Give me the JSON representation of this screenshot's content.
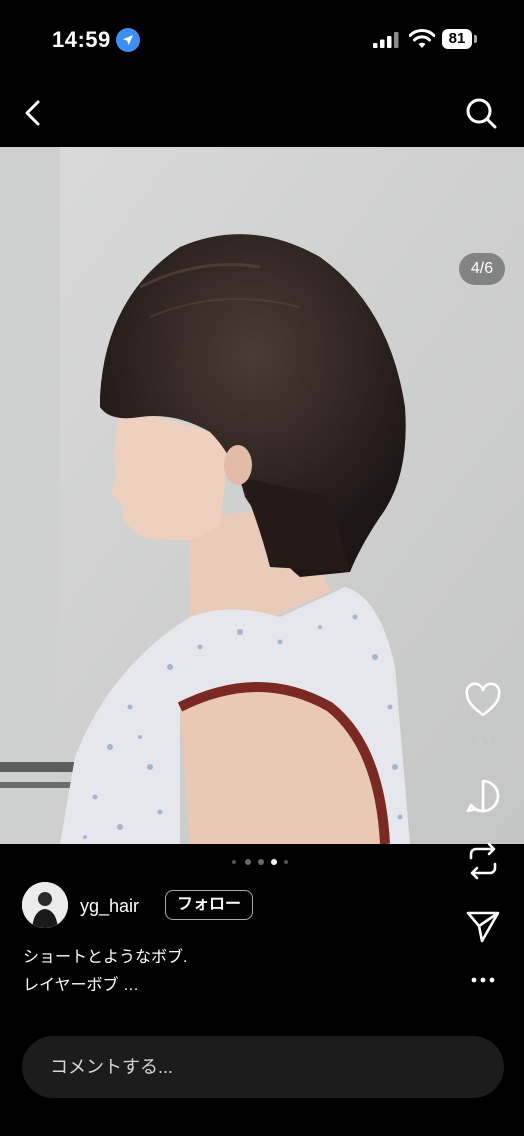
{
  "status_bar": {
    "time": "14:59",
    "battery": "81"
  },
  "post": {
    "page_indicator": "4/6",
    "carousel": {
      "count": 5,
      "active_index": 3
    },
    "author": {
      "username": "yg_hair",
      "follow_label": "フォロー"
    },
    "caption_line1": "ショートとようなボブ.",
    "caption_line2": "レイヤーボブ …",
    "like_count": "a !"
  },
  "comment": {
    "placeholder": "コメントする..."
  },
  "colors": {
    "background": "#000000",
    "input_bg": "#1c1c1d",
    "location_accent": "#3b8ff5"
  },
  "icons": {
    "back": "chevron-left-icon",
    "search": "search-icon",
    "like": "heart-icon",
    "comment": "comment-icon",
    "repost": "repost-icon",
    "share": "send-icon",
    "more": "more-icon"
  }
}
